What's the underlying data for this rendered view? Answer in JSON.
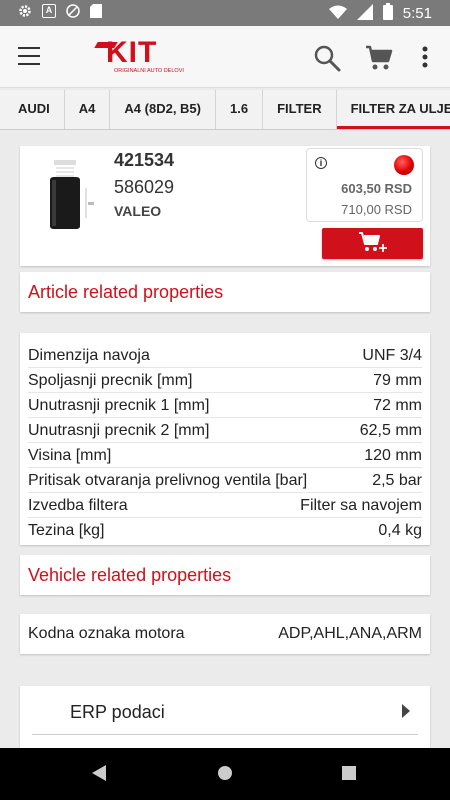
{
  "status_bar": {
    "time": "5:51",
    "notification_letter": "A"
  },
  "app_bar": {
    "logo_text": "KIT",
    "logo_tagline": "ORIGINALNI AUTO DELOVI"
  },
  "breadcrumbs": [
    {
      "label": "AUDI"
    },
    {
      "label": "A4"
    },
    {
      "label": "A4 (8D2, B5)"
    },
    {
      "label": "1.6"
    },
    {
      "label": "FILTER"
    },
    {
      "label": "FILTER ZA ULJE",
      "active": true
    }
  ],
  "product": {
    "code": "421534",
    "code2": "586029",
    "brand": "VALEO",
    "price": "603,50 RSD",
    "list_price": "710,00 RSD",
    "availability_color": "#e00000"
  },
  "article_section": {
    "title": "Article related properties",
    "properties": [
      {
        "name": "Dimenzija navoja",
        "value": "UNF 3/4"
      },
      {
        "name": "Spoljasnji precnik [mm]",
        "value": "79 mm"
      },
      {
        "name": "Unutrasnji precnik 1 [mm]",
        "value": "72 mm"
      },
      {
        "name": "Unutrasnji precnik 2 [mm]",
        "value": "62,5 mm"
      },
      {
        "name": "Visina [mm]",
        "value": "120 mm"
      },
      {
        "name": "Pritisak otvaranja prelivnog ventila [bar]",
        "value": "2,5 bar"
      },
      {
        "name": "Izvedba filtera",
        "value": "Filter sa navojem"
      },
      {
        "name": "Tezina [kg]",
        "value": "0,4 kg"
      }
    ]
  },
  "vehicle_section": {
    "title": "Vehicle related properties",
    "properties": [
      {
        "name": "Kodna oznaka motora",
        "value": "ADP,AHL,ANA,ARM"
      }
    ]
  },
  "erp": {
    "label": "ERP podaci"
  },
  "colors": {
    "brand_red": "#d0101a",
    "status_bar": "#7a7a7a"
  }
}
